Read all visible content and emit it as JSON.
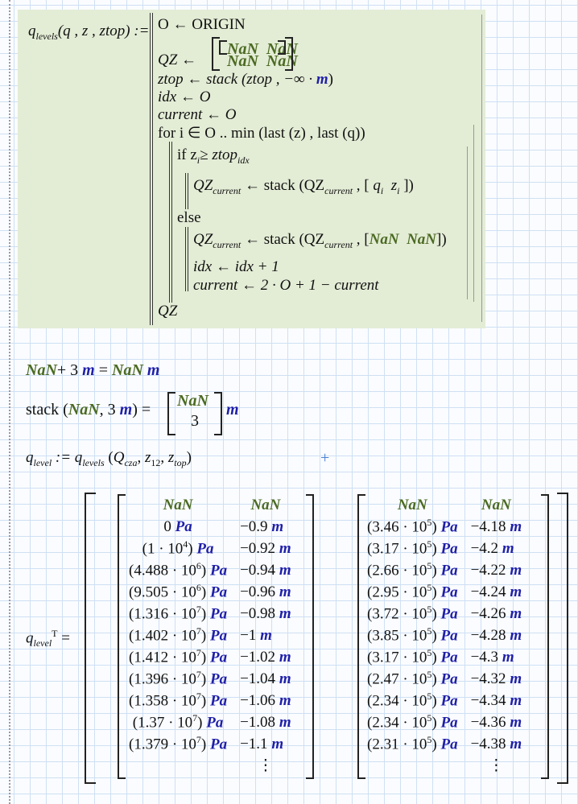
{
  "program": {
    "def": "q",
    "def_sub": "levels",
    "def_args": "(q , z , ztop) :=",
    "lines": {
      "origin": "O ← ORIGIN",
      "qz_init": "QZ ←",
      "nan": "NaN",
      "ztop": "ztop ← stack (ztop , −∞ · ",
      "unit_m": "m",
      "idx": "idx ← O",
      "current": "current ← O",
      "for": "for i ∈ O .. min (last (z) , last (q))",
      "if": "if z",
      "if_rest": "≥ ztop",
      "if_sub_i": "i",
      "if_sub_idx": "idx",
      "qz_cur": "QZ",
      "sub_current": "current",
      "stack": "← stack (QZ",
      "qi": "q",
      "zi": "z",
      "else": "else",
      "idx_inc": "idx ← idx + 1",
      "cur_flip": "current ← 2 · O + 1 − current",
      "ret": "QZ"
    }
  },
  "eq1": {
    "nan": "NaN",
    "plus": "+ 3 ",
    "unit": "m",
    "eq": " = "
  },
  "eq2": {
    "stack": "stack (",
    "nan": "NaN",
    ", three": ", 3 ",
    "unit": "m",
    "close": ") =",
    "three": "3"
  },
  "eq3": {
    "lhs": "q",
    "lhs_sub": "level",
    "assign": " := q",
    "fn_sub": "levels",
    "arg1": "Q",
    "arg1_sub": "cza",
    "arg2": "z",
    "arg2_sub": "12",
    "arg3": "z",
    "arg3_sub": "top"
  },
  "result": {
    "lhs": "q",
    "lhs_sub": "level",
    "lhs_sup": "T",
    "eq": "=",
    "matrix1": {
      "headers": [
        "NaN",
        "NaN"
      ],
      "rows": [
        {
          "q": "0",
          "z": "−0.9"
        },
        {
          "m": "1",
          "e": "4",
          "z": "−0.92"
        },
        {
          "m": "4.488",
          "e": "6",
          "z": "−0.94"
        },
        {
          "m": "9.505",
          "e": "6",
          "z": "−0.96"
        },
        {
          "m": "1.316",
          "e": "7",
          "z": "−0.98"
        },
        {
          "m": "1.402",
          "e": "7",
          "z": "−1"
        },
        {
          "m": "1.412",
          "e": "7",
          "z": "−1.02"
        },
        {
          "m": "1.396",
          "e": "7",
          "z": "−1.04"
        },
        {
          "m": "1.358",
          "e": "7",
          "z": "−1.06"
        },
        {
          "m": "1.37",
          "e": "7",
          "z": "−1.08"
        },
        {
          "m": "1.379",
          "e": "7",
          "z": "−1.1"
        }
      ]
    },
    "matrix2": {
      "headers": [
        "NaN",
        "NaN"
      ],
      "rows": [
        {
          "m": "3.46",
          "e": "5",
          "z": "−4.18"
        },
        {
          "m": "3.17",
          "e": "5",
          "z": "−4.2"
        },
        {
          "m": "2.66",
          "e": "5",
          "z": "−4.22"
        },
        {
          "m": "2.95",
          "e": "5",
          "z": "−4.24"
        },
        {
          "m": "3.72",
          "e": "5",
          "z": "−4.26"
        },
        {
          "m": "3.85",
          "e": "5",
          "z": "−4.28"
        },
        {
          "m": "3.17",
          "e": "5",
          "z": "−4.3"
        },
        {
          "m": "2.47",
          "e": "5",
          "z": "−4.32"
        },
        {
          "m": "2.34",
          "e": "5",
          "z": "−4.34"
        },
        {
          "m": "2.34",
          "e": "5",
          "z": "−4.36"
        },
        {
          "m": "2.31",
          "e": "5",
          "z": "−4.38"
        }
      ]
    },
    "unit_q": "Pa",
    "unit_z": "m",
    "ellipsis": "⋮"
  },
  "colors": {
    "nan": "#4b6a22",
    "unit": "#1f1fa8",
    "region": "#e3ecd5"
  }
}
